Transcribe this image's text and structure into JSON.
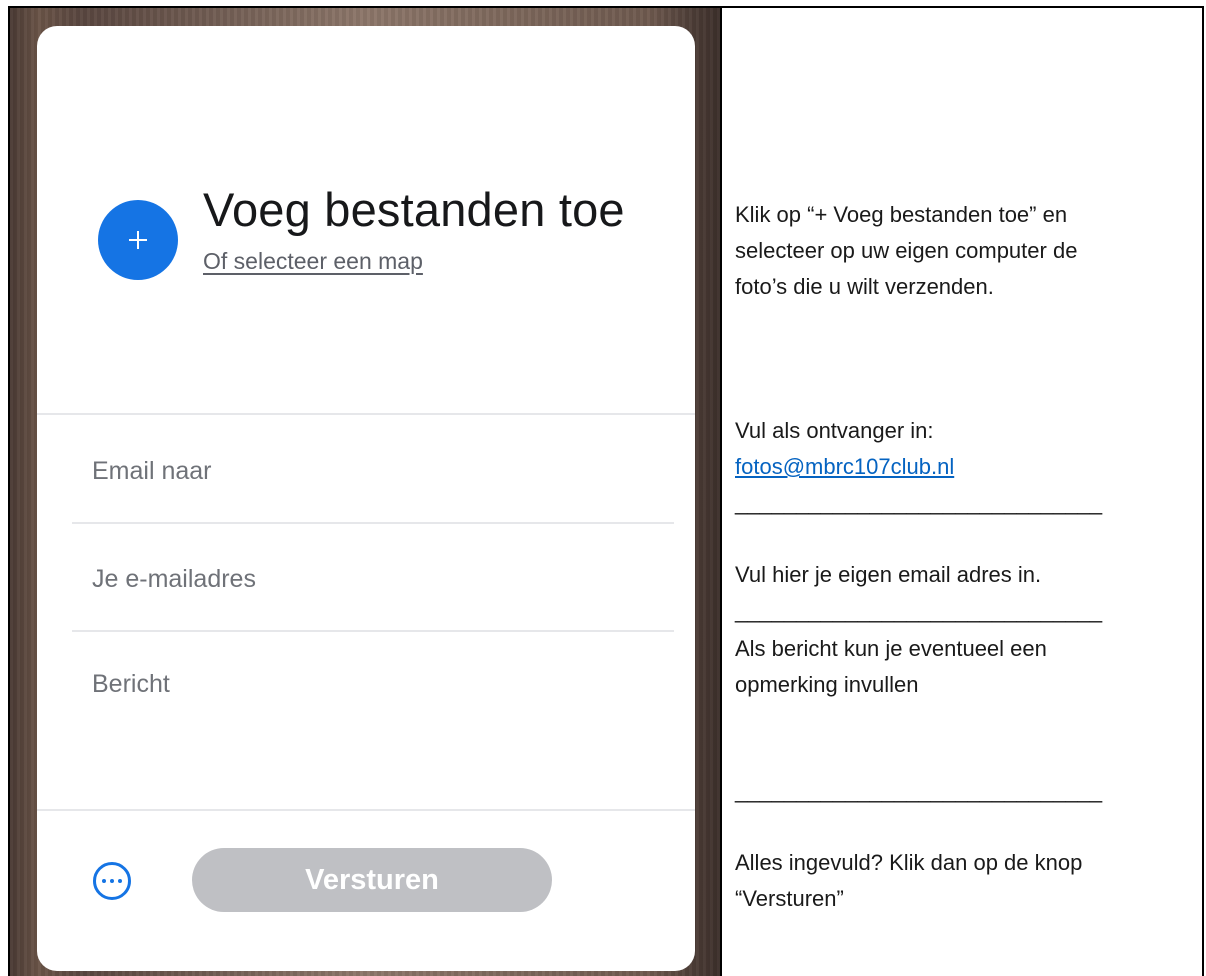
{
  "upload_card": {
    "add_title": "Voeg bestanden toe",
    "folder_link": "Of selecteer een map",
    "email_to_placeholder": "Email naar",
    "your_email_placeholder": "Je e-mailadres",
    "message_placeholder": "Bericht",
    "send_label": "Versturen",
    "accent_color": "#1574e4",
    "send_button_color": "#bfc0c4"
  },
  "instructions": {
    "step1": [
      "Klik op “+ Voeg bestanden toe” en",
      "selecteer op uw eigen computer de",
      "foto’s die u wilt verzenden."
    ],
    "step2_line": "Vul als ontvanger in:",
    "step2_link": "fotos@mbrc107club.nl",
    "separator": "______________________________",
    "step3": "Vul hier je eigen email adres in.",
    "step4": [
      "Als bericht kun je eventueel een",
      "opmerking invullen"
    ],
    "step5": [
      "Alles ingevuld? Klik dan op de knop",
      "“Versturen”"
    ]
  }
}
